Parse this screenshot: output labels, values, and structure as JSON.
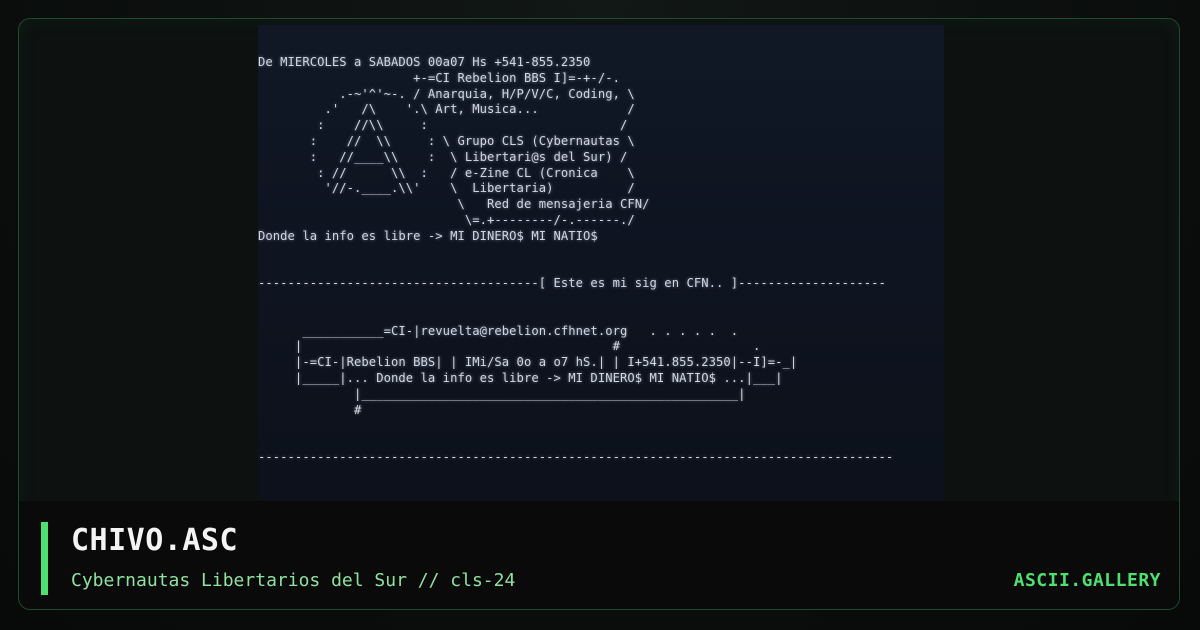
{
  "art": {
    "lines": [
      "De MIERCOLES a SABADOS 00a07 Hs +541-855.2350",
      "                     +-=CI Rebelion BBS I]=-+-/-.",
      "           .-~'^'~-. / Anarquia, H/P/V/C, Coding, \\",
      "         .'   /\\    '.\\ Art, Musica...            /",
      "        :    //\\\\     :                          /",
      "       :    //  \\\\     : \\ Grupo CLS (Cybernautas \\",
      "       :   //____\\\\    :  \\ Libertari@s del Sur) /",
      "        : //      \\\\  :   / e-Zine CL (Cronica    \\",
      "         '//-.____.\\\\'    \\  Libertaria)          /",
      "                           \\   Red de mensajeria CFN/",
      "                            \\=.+--------/-.------./",
      "Donde la info es libre -> MI DINERO$ MI NATIO$",
      "",
      "",
      "--------------------------------------[ Este es mi sig en CFN.. ]--------------------",
      "",
      "",
      "      ___________=CI-|revuelta@rebelion.cfhnet.org   . . . . .  .",
      "     |                                          #                  .",
      "     |-=CI-|Rebelion BBS| | IMi/Sa 0o a o7 hS.| | I+541.855.2350|--I]=-_|",
      "     |_____|... Donde la info es libre -> MI DINERO$ MI NATIO$ ...|___|",
      "             |___________________________________________________|",
      "             #",
      "",
      "",
      "--------------------------------------------------------------------------------------"
    ]
  },
  "footer": {
    "title": "CHIVO.ASC",
    "subtitle": "Cybernautas Libertarios del Sur // cls-24",
    "brand": "ASCII.GALLERY"
  },
  "colors": {
    "accent": "#4ee06f",
    "subtitle": "#8fe0a0",
    "frame_border": "#1f4a2c",
    "art_text": "#cfd6e2"
  }
}
